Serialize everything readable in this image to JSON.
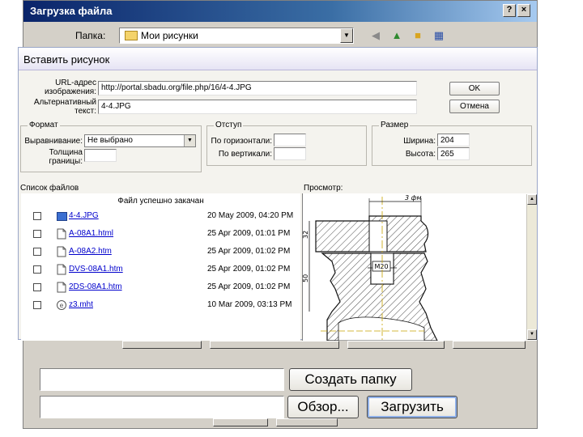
{
  "upload_window": {
    "title": "Загрузка файла",
    "help_btn": "?",
    "close_btn": "×",
    "look_in_label": "Папка:",
    "look_in_value": "Мои рисунки",
    "tool_icons": [
      "back-icon",
      "up-folder-icon",
      "new-folder-icon",
      "views-icon"
    ],
    "create_folder_button": "Создать папку",
    "browse_button": "Обзор...",
    "upload_button": "Загрузить"
  },
  "insert_dialog": {
    "title": "Вставить рисунок",
    "url_label": "URL-адрес изображения:",
    "url_value": "http://portal.sbadu.org/file.php/16/4-4.JPG",
    "alt_label": "Альтернативный текст:",
    "alt_value": "4-4.JPG",
    "ok_button": "OK",
    "cancel_button": "Отмена",
    "format": {
      "title": "Формат",
      "align_label": "Выравнивание:",
      "align_value": "Не выбрано",
      "border_label": "Толщина границы:"
    },
    "spacing": {
      "title": "Отступ",
      "horizontal_label": "По горизонтали:",
      "vertical_label": "По вертикали:"
    },
    "size": {
      "title": "Размер",
      "width_label": "Ширина:",
      "width_value": "204",
      "height_label": "Высота:",
      "height_value": "265"
    },
    "file_list_label": "Список файлов",
    "preview_label": "Просмотр:",
    "status": "Файл успешно закачан",
    "files": [
      {
        "name": "4-4.JPG",
        "date": "20 May 2009, 04:20 PM",
        "icon": "image-file-icon"
      },
      {
        "name": "A-08A1.html",
        "date": "25 Apr 2009, 01:01 PM",
        "icon": "html-file-icon"
      },
      {
        "name": "A-08A2.htm",
        "date": "25 Apr 2009, 01:02 PM",
        "icon": "html-file-icon"
      },
      {
        "name": "DVS-08A1.htm",
        "date": "25 Apr 2009, 01:02 PM",
        "icon": "html-file-icon"
      },
      {
        "name": "2DS-08A1.htm",
        "date": "25 Apr 2009, 01:02 PM",
        "icon": "html-file-icon"
      },
      {
        "name": "z3.mht",
        "date": "10 Mar 2009, 03:13 PM",
        "icon": "mht-file-icon"
      }
    ]
  },
  "drawing": {
    "dim_top": "3 фм",
    "dim_left_top": "32",
    "dim_left_bottom": "50",
    "thread_label": "M20"
  },
  "colors": {
    "title_bar": "#0a246a",
    "link": "#0000cc",
    "dialog_bg": "#f4f3ee"
  }
}
